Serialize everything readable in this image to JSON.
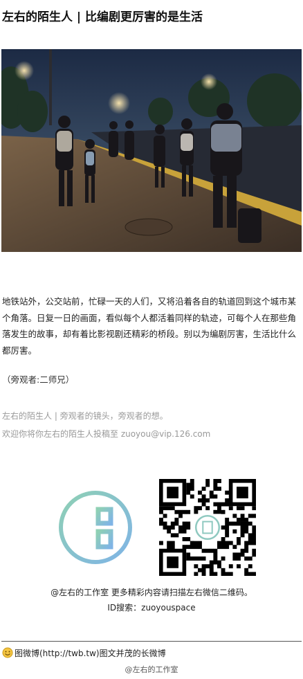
{
  "article": {
    "title": "左右的陌生人 | 比编剧更厉害的是生活",
    "body": "地铁站外，公交站前，忙碌一天的人们，又将沿着各自的轨道回到这个城市某个角落。日复一日的画面，看似每个人都活着同样的轨迹，可每个人在那些角落发生的故事，却有着比影视剧还精彩的桥段。别以为编剧厉害，生活比什么都厉害。",
    "observer": "（旁观者:二师兄）",
    "series_line": "左右的陌生人 | 旁观者的镜头，旁观者的想。",
    "submit_line": "欢迎你将你左右的陌生人投稿至 zuoyou@vip.126.com"
  },
  "promo": {
    "caption_line1": "@左右的工作室 更多精彩内容请扫描左右微信二维码。",
    "caption_line2": "ID搜索：zuoyouspace"
  },
  "footer": {
    "weibo_line": "图微博(http://twb.tw)图文并茂的长微博",
    "credit": "@左右的工作室"
  },
  "icons": {
    "photo": "night-bus-stop-photo",
    "logo": "zuoyou-logo-icon",
    "qr": "qr-code-icon",
    "smiley": "smiley-icon"
  },
  "colors": {
    "logo_ring_start": "#8fd0b4",
    "logo_ring_end": "#7fb4e6",
    "muted_text": "#999999"
  }
}
